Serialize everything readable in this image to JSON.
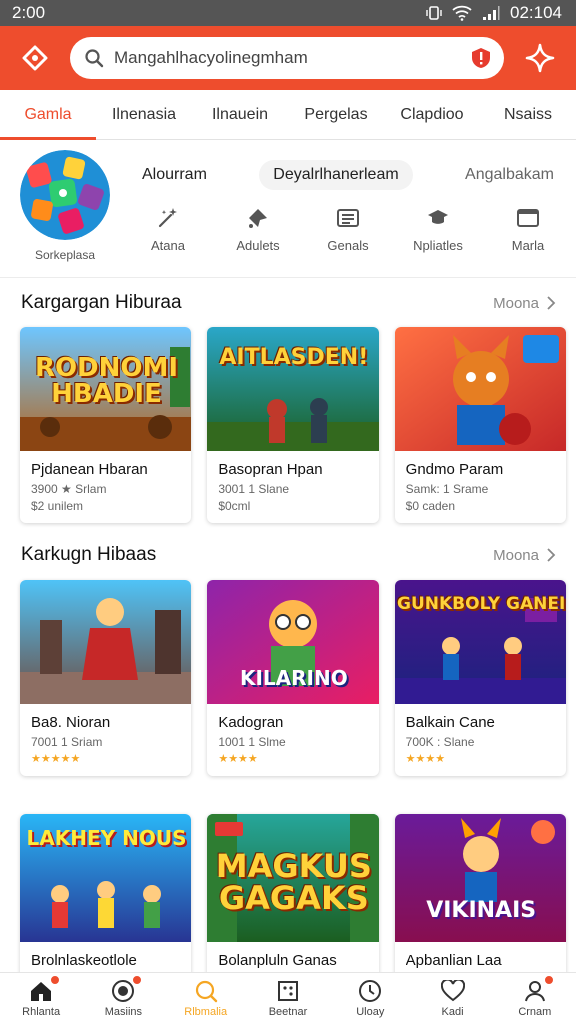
{
  "status_bar": {
    "time": "2:00",
    "clock_right": "02:104"
  },
  "header": {
    "search_placeholder": "Mangahlhacyolinegmham",
    "colors": {
      "brand": "#ee4d2d",
      "accent": "#f5a623"
    }
  },
  "tabs": [
    {
      "label": "Gamla",
      "active": true
    },
    {
      "label": "Ilnenasia"
    },
    {
      "label": "Ilnauein"
    },
    {
      "label": "Pergelas"
    },
    {
      "label": "Clapdioo"
    },
    {
      "label": "Nsaiss"
    }
  ],
  "category": {
    "avatar_label": "Sorkeplasa",
    "pills": [
      "Alourram",
      "Deyalrlhanerleam",
      "Angalbakam"
    ],
    "icons": [
      {
        "label": "Atana",
        "icon": "magic-wand-icon"
      },
      {
        "label": "Adulets",
        "icon": "paint-icon"
      },
      {
        "label": "Genals",
        "icon": "list-card-icon"
      },
      {
        "label": "Npliatles",
        "icon": "hat-icon"
      },
      {
        "label": "Marla",
        "icon": "window-icon"
      }
    ]
  },
  "sections": [
    {
      "title": "Kargargan Hiburaa",
      "more": "Moona",
      "cards": [
        {
          "art_text": "RODNOMI HBADIE",
          "title": "Pjdanean Hbaran",
          "meta": "3900 ★ Srlam",
          "price": "$2 unilem"
        },
        {
          "art_text": "AITLASDEN!",
          "title": "Basopran Hpan",
          "meta": "3001 1 Slane",
          "price": "$0cml"
        },
        {
          "art_text": "",
          "title": "Gndmo Param",
          "meta": "Samk: 1 Srame",
          "price": "$0 caden"
        }
      ]
    },
    {
      "title": "Karkugn Hibaas",
      "more": "Moona",
      "cards": [
        {
          "art_text": "",
          "title": "Ba8. Nioran",
          "meta": "7001 1 Sriam",
          "stars": "★★★★★"
        },
        {
          "art_text": "KILARINO",
          "title": "Kadogran",
          "meta": "1001 1 Slme",
          "stars": "★★★★"
        },
        {
          "art_text": "GUNKBOLY GANEI",
          "title": "Balkain Cane",
          "meta": "700K : Slane",
          "stars": "★★★★"
        }
      ]
    },
    {
      "cards": [
        {
          "art_text": "LAKHEY NOUS",
          "title": "Brolnlaskeotlole"
        },
        {
          "art_text": "MAGKUS GAGAKS",
          "title": "Bolanpluln Ganas"
        },
        {
          "art_text": "VIKINAIS",
          "title": "Apbanlian Laa"
        }
      ]
    }
  ],
  "bottom_nav": [
    {
      "label": "Rhlanta",
      "icon": "home-icon",
      "badge": true
    },
    {
      "label": "Masiins",
      "icon": "target-icon",
      "badge": true
    },
    {
      "label": "Rlbmalia",
      "icon": "search-icon",
      "active": true
    },
    {
      "label": "Beetnar",
      "icon": "grid-icon"
    },
    {
      "label": "Uloay",
      "icon": "clock-icon"
    },
    {
      "label": "Kadi",
      "icon": "heart-icon"
    },
    {
      "label": "Crnam",
      "icon": "person-icon",
      "badge": true
    }
  ]
}
